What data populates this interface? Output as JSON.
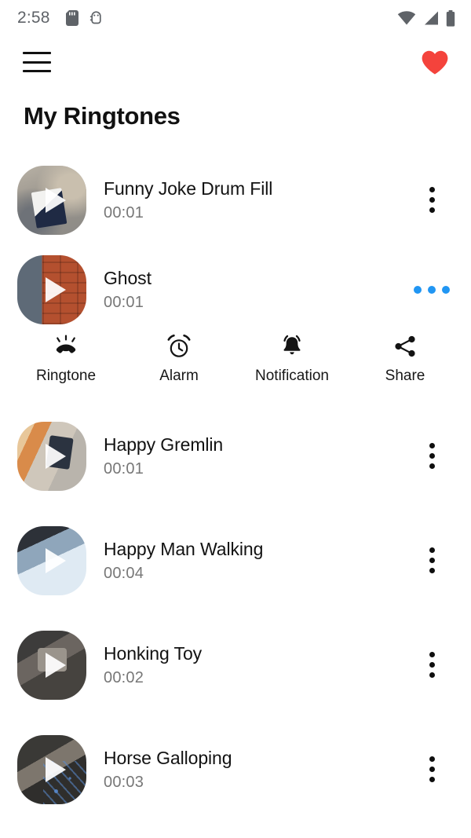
{
  "status_bar": {
    "time": "2:58",
    "left_icons": [
      "sd-card-icon",
      "android-debug-icon"
    ],
    "right_icons": [
      "wifi-icon",
      "cellular-signal-icon",
      "battery-icon"
    ]
  },
  "app_bar": {
    "menu_icon": "hamburger-menu-icon",
    "favorite_icon": "heart-icon",
    "favorite_color": "#f4433c"
  },
  "page": {
    "title": "My Ringtones"
  },
  "active_menu_color": "#2196f3",
  "expanded_actions": [
    {
      "label": "Ringtone",
      "icon": "ringing-phone-icon"
    },
    {
      "label": "Alarm",
      "icon": "alarm-clock-icon"
    },
    {
      "label": "Notification",
      "icon": "bell-icon"
    },
    {
      "label": "Share",
      "icon": "share-icon"
    }
  ],
  "ringtones": [
    {
      "title": "Funny Joke Drum Fill",
      "duration": "00:01",
      "thumb": "ph-sand",
      "expanded": false
    },
    {
      "title": "Ghost",
      "duration": "00:01",
      "thumb": "ph-brick",
      "expanded": true
    },
    {
      "title": "Happy Gremlin",
      "duration": "00:01",
      "thumb": "ph-blonde",
      "expanded": false
    },
    {
      "title": "Happy Man Walking",
      "duration": "00:04",
      "thumb": "ph-lightblue",
      "expanded": false
    },
    {
      "title": "Honking Toy",
      "duration": "00:02",
      "thumb": "ph-suit",
      "expanded": false
    },
    {
      "title": "Horse Galloping",
      "duration": "00:03",
      "thumb": "ph-doodle",
      "expanded": false
    }
  ]
}
